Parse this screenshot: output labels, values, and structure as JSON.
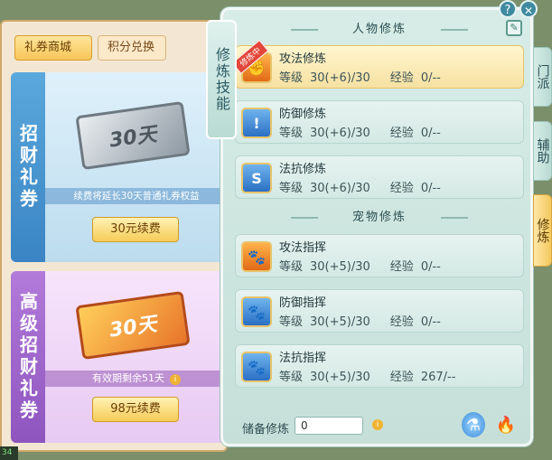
{
  "shop": {
    "tabs": [
      "礼券商城",
      "积分兑换"
    ],
    "card1": {
      "side_label": "招财礼券",
      "ticket_text": "30天",
      "note": "续费将延长30天普通礼券权益",
      "button": "30元续费"
    },
    "card2": {
      "side_label": "高级招财礼券",
      "ticket_text": "30天",
      "note": "有效期剩余51天",
      "button": "98元续费"
    }
  },
  "panel": {
    "title": "修炼技能",
    "help": "?",
    "close": "✕",
    "person_header": "人物修炼",
    "pet_header": "宠物修炼",
    "level_label": "等级",
    "exp_label": "经验",
    "person_skills": [
      {
        "name": "攻法修炼",
        "level": "30(+6)/30",
        "exp": "0/--",
        "badge": "修炼中",
        "icon": "attack-icon"
      },
      {
        "name": "防御修炼",
        "level": "30(+6)/30",
        "exp": "0/--",
        "icon": "defense-icon"
      },
      {
        "name": "法抗修炼",
        "level": "30(+6)/30",
        "exp": "0/--",
        "icon": "resist-icon"
      }
    ],
    "pet_skills": [
      {
        "name": "攻法指挥",
        "level": "30(+5)/30",
        "exp": "0/--",
        "icon": "paw-attack-icon"
      },
      {
        "name": "防御指挥",
        "level": "30(+5)/30",
        "exp": "0/--",
        "icon": "paw-defense-icon"
      },
      {
        "name": "法抗指挥",
        "level": "30(+5)/30",
        "exp": "267/--",
        "icon": "paw-resist-icon"
      }
    ],
    "reserve_label": "储备修炼",
    "reserve_value": "0"
  },
  "side_tabs": [
    "门派",
    "辅助",
    "修炼"
  ],
  "corner_text": "34"
}
